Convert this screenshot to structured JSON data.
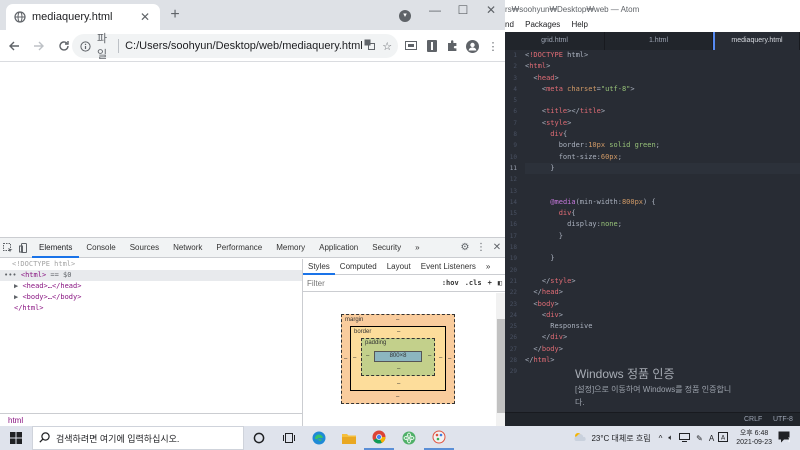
{
  "browser": {
    "tab_title": "mediaquery.html",
    "address_scheme": "파일",
    "address_url": "C:/Users/soohyun/Desktop/web/mediaquery.html"
  },
  "devtools": {
    "tabs": [
      "Elements",
      "Console",
      "Sources",
      "Network",
      "Performance",
      "Memory",
      "Application",
      "Security"
    ],
    "more": "»",
    "dom": {
      "doctype": "<!DOCTYPE html>",
      "html_open": "<html>",
      "html_suffix": "== $0",
      "head": "<head>…</head>",
      "body": "<body>…</body>",
      "html_close": "</html>"
    },
    "breadcrumb": "html",
    "styles_tabs": [
      "Styles",
      "Computed",
      "Layout",
      "Event Listeners"
    ],
    "styles_more": "»",
    "filter_placeholder": "Filter",
    "filter_hov": ":hov",
    "filter_cls": ".cls",
    "filter_plus": "+",
    "box_model": {
      "margin_label": "margin",
      "border_label": "border",
      "padding_label": "padding",
      "content": "800×8",
      "dash": "–"
    }
  },
  "atom": {
    "window_title": "rs₩soohyun₩Desktop₩web — Atom",
    "menu": [
      "nd",
      "Packages",
      "Help"
    ],
    "tabs": [
      "grid.html",
      "1.html",
      "mediaquery.html"
    ],
    "active_tab": 2,
    "line_numbers": [
      "1",
      "2",
      "3",
      "4",
      "5",
      "6",
      "7",
      "8",
      "9",
      "10",
      "11",
      "12",
      "13",
      "14",
      "15",
      "16",
      "17",
      "18",
      "19",
      "20",
      "21",
      "22",
      "23",
      "24",
      "25",
      "26",
      "27",
      "28",
      "29"
    ],
    "status_right": [
      "CRLF",
      "UTF-8"
    ]
  },
  "code_lines": [
    "<!DOCTYPE html>",
    "<html>",
    "  <head>",
    "    <meta charset=\"utf-8\">",
    "",
    "    <title></title>",
    "    <style>",
    "      div{",
    "        border:10px solid green;",
    "        font-size:60px;",
    "      }",
    "",
    "",
    "      @media(min-width:800px) {",
    "        div{",
    "          display:none;",
    "        }",
    "",
    "      }",
    "",
    "    </style>",
    "  </head>",
    "  <body>",
    "    <div>",
    "      Responsive",
    "    </div>",
    "  </body>",
    "</html>",
    ""
  ],
  "watermark": {
    "title": "Windows 정품 인증",
    "line1": "[설정]으로 이동하여 Windows를 정품 인증합니",
    "line2": "다."
  },
  "taskbar": {
    "search_placeholder": "검색하려면 여기에 입력하십시오.",
    "weather": "23°C 대체로 흐림",
    "ime": "A",
    "time": "오후 6:48",
    "date": "2021-09-23"
  },
  "colors": {
    "atom_bg": "#282c34",
    "tag": "#e06c75",
    "attr": "#d19a66",
    "string": "#98c379",
    "keyword": "#c678dd",
    "accent": "#1a73e8"
  }
}
